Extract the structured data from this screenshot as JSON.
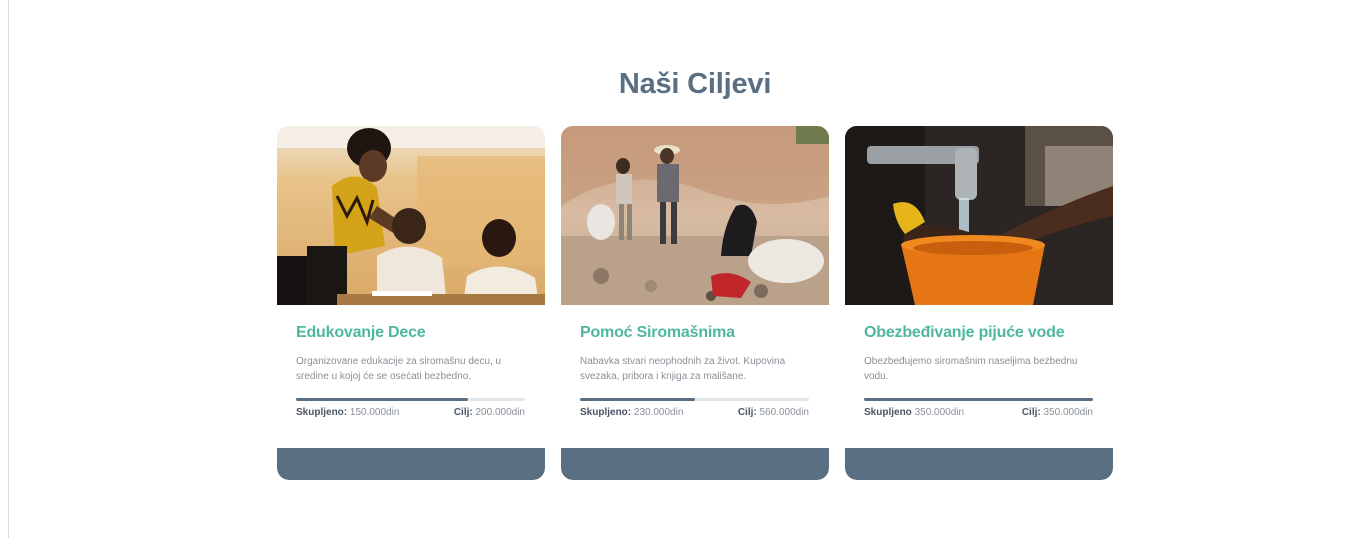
{
  "section": {
    "title": "Naši Ciljevi"
  },
  "cards": [
    {
      "title": "Edukovanje Dece",
      "description": "Organizovane edukacije za siromašnu decu, u sredine u kojoj će se osećati bezbedno.",
      "raised_label": "Skupljeno:",
      "raised_value": "150.000din",
      "goal_label": "Cilj:",
      "goal_value": "200.000din",
      "progress": 0.75
    },
    {
      "title": "Pomoć Siromašnima",
      "description": "Nabavka stvari neophodnih za život. Kupovina svezaka, pribora i knjiga za mališane.",
      "raised_label": "Skupljeno:",
      "raised_value": "230.000din",
      "goal_label": "Cilj:",
      "goal_value": "560.000din",
      "progress": 0.5
    },
    {
      "title": "Obezbeđivanje pijuće vode",
      "description": "Obezbeđujemo siromašnim naseljima bezbednu vodu.",
      "raised_label": "Skupljeno",
      "raised_value": "350.000din",
      "goal_label": "Cilj:",
      "goal_value": "350.000din",
      "progress": 1.0
    }
  ],
  "colors": {
    "title": "#5a6f82",
    "card_title": "#4db89d",
    "accent": "#5a6f82",
    "track": "#e3e6e9",
    "body_text": "#8a9099"
  }
}
